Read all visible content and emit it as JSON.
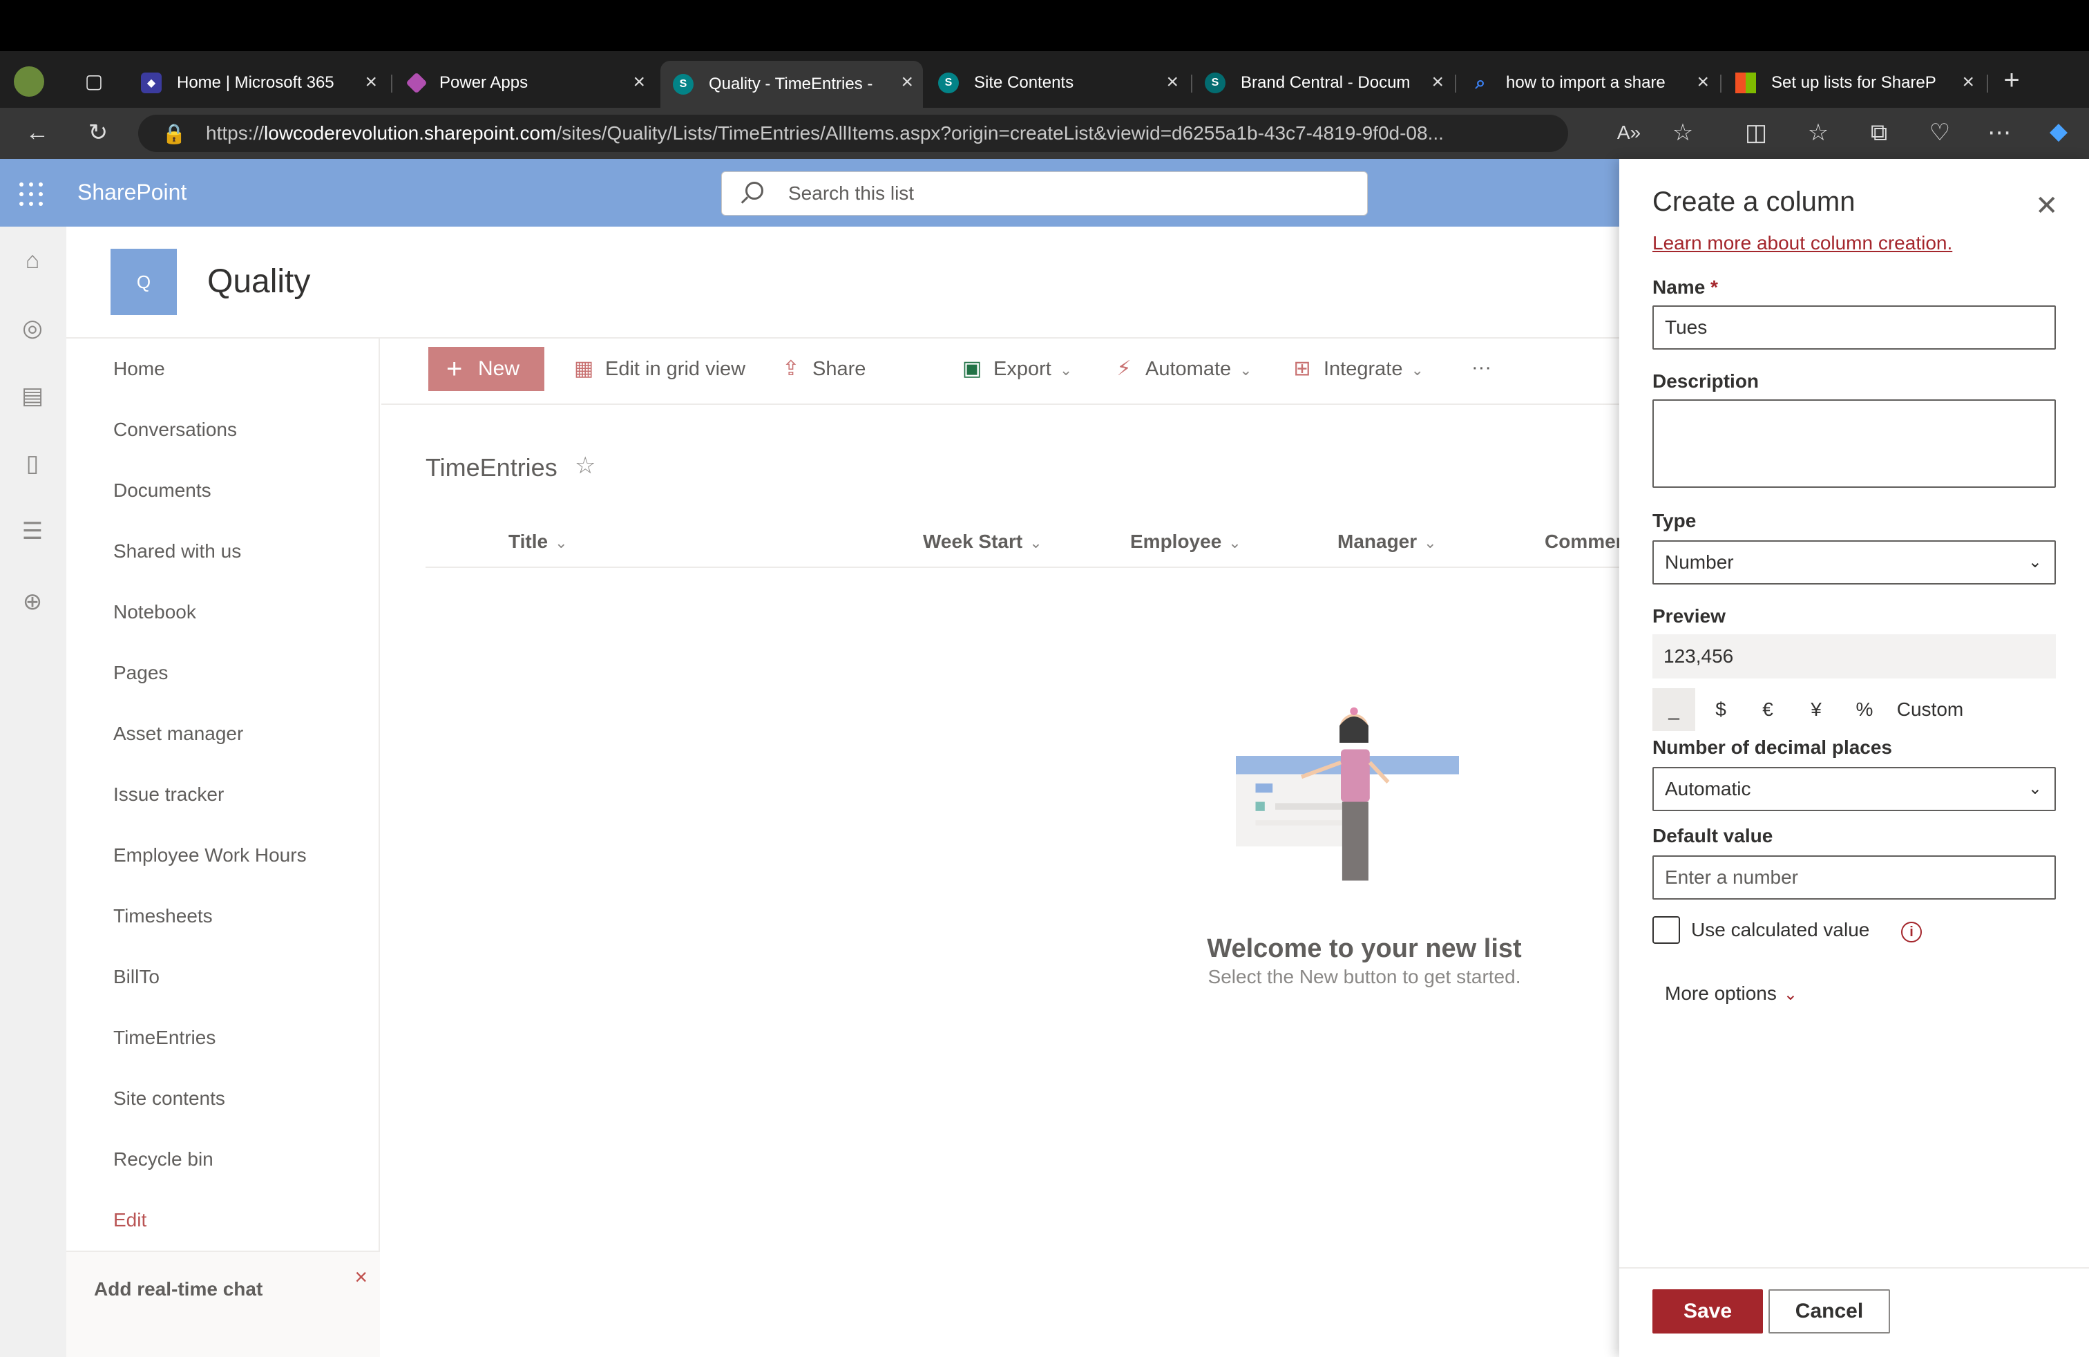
{
  "browser": {
    "tabs": [
      {
        "title": "Home | Microsoft 365",
        "icon": "m365-icon",
        "color": "#4a3bb0"
      },
      {
        "title": "Power Apps",
        "icon": "powerapps-icon",
        "color": "#b04fb0"
      },
      {
        "title": "Quality - TimeEntries -",
        "icon": "sharepoint-icon",
        "color": "#038387"
      },
      {
        "title": "Site Contents",
        "icon": "sharepoint-icon",
        "color": "#038387"
      },
      {
        "title": "Brand Central - Docum",
        "icon": "sharepoint-icon",
        "color": "#036c70"
      },
      {
        "title": "how to import a share",
        "icon": "search-icon",
        "color": "#1f6feb"
      },
      {
        "title": "Set up lists for ShareP",
        "icon": "microsoft-icon",
        "color": "#f25022"
      }
    ],
    "url_prefix": "https://",
    "url_domain": "lowcoderevolution.sharepoint.com",
    "url_path": "/sites/Quality/Lists/TimeEntries/AllItems.aspx?origin=createList&viewid=d6255a1b-43c7-4819-9f0d-08..."
  },
  "sharepoint": {
    "brand": "SharePoint",
    "search_placeholder": "Search this list",
    "site_logo_letter": "Q",
    "site_title": "Quality",
    "nav": [
      "Home",
      "Conversations",
      "Documents",
      "Shared with us",
      "Notebook",
      "Pages",
      "Asset manager",
      "Issue tracker",
      "Employee Work Hours",
      "Timesheets",
      "BillTo",
      "TimeEntries",
      "Site contents",
      "Recycle bin"
    ],
    "nav_edit": "Edit",
    "chat_promo": "Add real-time chat",
    "commands": {
      "new": "New",
      "edit_grid": "Edit in grid view",
      "share": "Share",
      "export": "Export",
      "automate": "Automate",
      "integrate": "Integrate",
      "more": "···"
    },
    "list_title": "TimeEntries",
    "columns": [
      "Title",
      "Week Start",
      "Employee",
      "Manager",
      "Commen"
    ],
    "empty_title": "Welcome to your new list",
    "empty_subtitle": "Select the New button to get started."
  },
  "panel": {
    "title": "Create a column",
    "learn_link": "Learn more about column creation.",
    "name_label": "Name",
    "required_mark": "*",
    "name_value": "Tues",
    "description_label": "Description",
    "type_label": "Type",
    "type_value": "Number",
    "preview_label": "Preview",
    "preview_value": "123,456",
    "formats": [
      "_",
      "$",
      "€",
      "¥",
      "%",
      "Custom"
    ],
    "decimal_label": "Number of decimal places",
    "decimal_value": "Automatic",
    "default_label": "Default value",
    "default_placeholder": "Enter a number",
    "calculated_label": "Use calculated value",
    "more_options": "More options",
    "save": "Save",
    "cancel": "Cancel"
  },
  "colors": {
    "suite_bar": "#7ea4da",
    "accent": "#a4262c"
  }
}
